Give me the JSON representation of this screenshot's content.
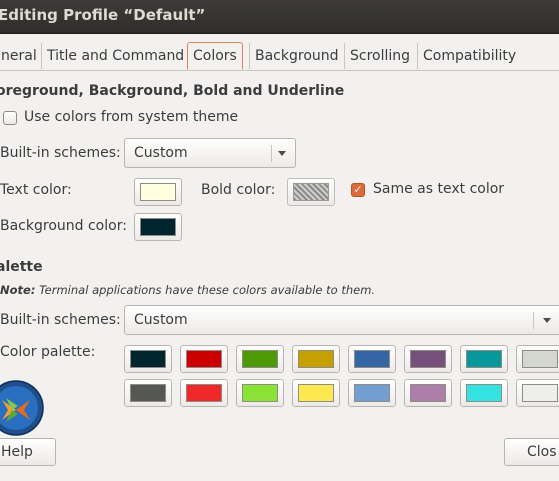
{
  "window": {
    "title": "Editing Profile “Default”"
  },
  "tabs": [
    {
      "label": "neral",
      "active": false
    },
    {
      "label": "Title and Command",
      "active": false
    },
    {
      "label": "Colors",
      "active": true
    },
    {
      "label": "Background",
      "active": false
    },
    {
      "label": "Scrolling",
      "active": false
    },
    {
      "label": "Compatibility",
      "active": false
    }
  ],
  "foreground": {
    "heading": "oreground, Background, Bold and Underline",
    "use_system_theme": {
      "label": "Use colors from system theme",
      "checked": false
    },
    "builtin_label": "Built-in schemes:",
    "builtin_value": "Custom",
    "text_color_label": "Text color:",
    "text_color": "#ffffdd",
    "bold_color_label": "Bold color:",
    "bold_color": "#a0a0a0",
    "same_as_text": {
      "label": "Same as text color",
      "checked": true
    },
    "background_color_label": "Background color:",
    "background_color": "#00252e"
  },
  "palette": {
    "heading": "alette",
    "note_bold": "Note:",
    "note_text": " Terminal applications have these colors available to them.",
    "builtin_label": "Built-in schemes:",
    "builtin_value": "Custom",
    "color_palette_label": "Color palette:",
    "row1": [
      "#00252e",
      "#cc0000",
      "#4e9a06",
      "#c4a000",
      "#3465a4",
      "#75507b",
      "#06989a",
      "#d3d7cf"
    ],
    "row2": [
      "#555753",
      "#ef2929",
      "#8ae234",
      "#fce94f",
      "#729fcf",
      "#ad7fa8",
      "#34e2e2",
      "#eeeeec"
    ]
  },
  "footer": {
    "help_label": "Help",
    "close_label": "Clos"
  }
}
